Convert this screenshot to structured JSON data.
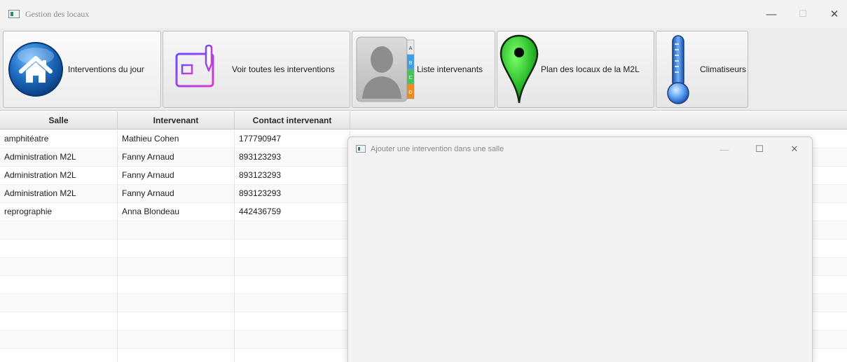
{
  "window": {
    "title": "Gestion des locaux",
    "minimize": "—",
    "maximize": "☐",
    "close": "✕"
  },
  "toolbar": {
    "buttons": [
      {
        "label": "Interventions du jour",
        "icon": "home-icon"
      },
      {
        "label": "Voir toutes les interventions",
        "icon": "document-edit-icon"
      },
      {
        "label": "Liste intervenants",
        "icon": "contacts-icon"
      },
      {
        "label": "Plan des locaux de la M2L",
        "icon": "map-pin-icon"
      },
      {
        "label": "Climatiseurs",
        "icon": "thermometer-icon"
      }
    ],
    "contacts_tabs": [
      "A",
      "B",
      "C",
      "D"
    ]
  },
  "table": {
    "columns": [
      "Salle",
      "Intervenant",
      "Contact intervenant"
    ],
    "rows": [
      [
        "amphitéatre",
        "Mathieu Cohen",
        "177790947"
      ],
      [
        "Administration M2L",
        "Fanny Arnaud",
        "893123293"
      ],
      [
        "Administration M2L",
        "Fanny Arnaud",
        "893123293"
      ],
      [
        "Administration M2L",
        "Fanny Arnaud",
        "893123293"
      ],
      [
        "reprographie",
        "Anna Blondeau",
        "442436759"
      ]
    ]
  },
  "dialog": {
    "title": "Ajouter une intervention dans une salle",
    "minimize": "—",
    "maximize": "☐",
    "close": "✕"
  },
  "colors": {
    "home_blue": "#1f6fc4",
    "doc_purple": "#a63ad0",
    "pin_green": "#2fbf2f",
    "thermo_blue": "#2f73d8",
    "contacts_gray": "#9a9a9a"
  }
}
